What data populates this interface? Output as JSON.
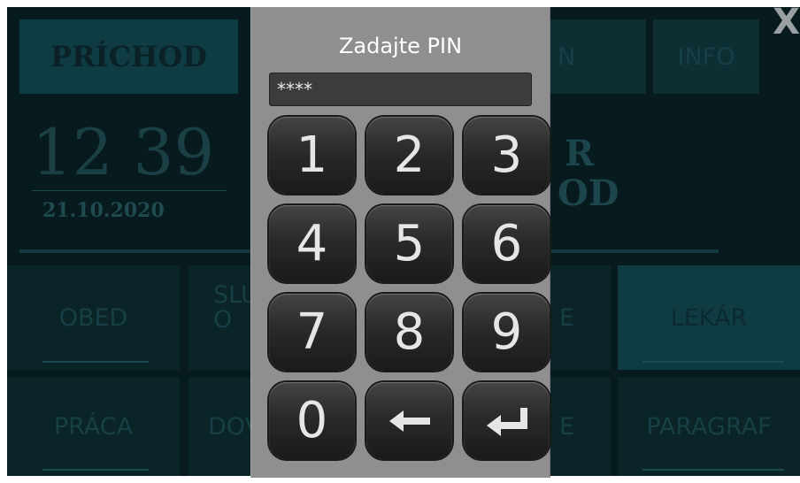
{
  "background": {
    "top_buttons": [
      "PRÍCHOD",
      "N",
      "INFO"
    ],
    "clock_time": "12 39",
    "clock_date": "21.10.2020",
    "mid_text_1": "R",
    "mid_text_2": "OD",
    "row1_left": "OBED",
    "row1_second": "SLU\nO",
    "row1_right_partial": "E",
    "row1_right": "LEKÁR",
    "row2_left": "PRÁCA",
    "row2_second": "DOV",
    "row2_right_partial": "E",
    "row2_right": "PARAGRAF"
  },
  "close_label": "X",
  "pin_dialog": {
    "title": "Zadajte PIN",
    "pin_value": "****",
    "keys": [
      "1",
      "2",
      "3",
      "4",
      "5",
      "6",
      "7",
      "8",
      "9",
      "0"
    ],
    "backspace_icon": "arrow-left-icon",
    "enter_icon": "enter-return-icon"
  }
}
